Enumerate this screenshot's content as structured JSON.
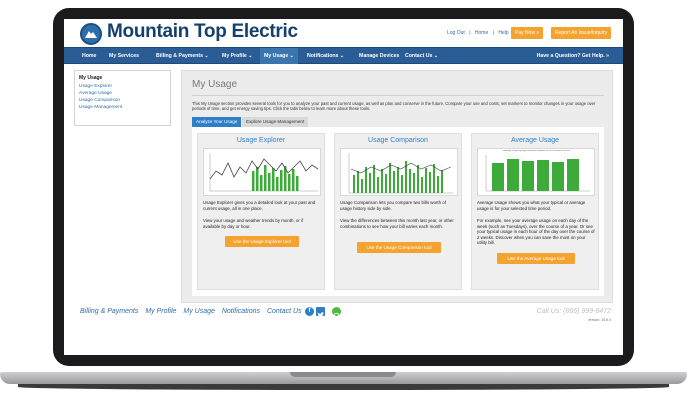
{
  "brand": {
    "name": "Mountain Top Electric",
    "accent": "#2a5d95",
    "orange": "#f4a331"
  },
  "top_links": [
    "Log Out",
    "|",
    "Home",
    "|",
    "Help"
  ],
  "header_buttons": {
    "pay": "Pay Now »",
    "report": "Report An Issue/Inquiry"
  },
  "nav": {
    "items": [
      "Home",
      "My Services",
      "Billing & Payments ⌄",
      "My Profile ⌄",
      "My Usage ⌄",
      "Notifications ⌄",
      "Manage Devices",
      "Contact Us ⌄"
    ],
    "active_index": 4,
    "help": "Have a Question? Get Help. »"
  },
  "sidebar": {
    "title": "My Usage",
    "links": [
      "Usage Explorer",
      "Average Usage",
      "Usage Comparison",
      "Usage Management"
    ]
  },
  "page": {
    "title": "My Usage",
    "intro": "This My Usage section provides several tools for you to analyze your past and current usage, as well as plan and conserve in the future. Compare your use and costs, set markers to monitor changes in your usage over periods of time, and get energy saving tips. Click the tabs below to learn more about these tools.",
    "tabs": [
      "Analyze Your Usage",
      "Explore Usage Management"
    ]
  },
  "cards": [
    {
      "title": "Usage Explorer",
      "text1": "Usage Explorer gives you a detailed look at your past and current usage, all in one place.",
      "text2": "View your usage and weather trends by month, or if available by day or hour.",
      "button": "Use the Usage Explorer tool"
    },
    {
      "title": "Usage Comparison",
      "text1": "Usage Comparison lets you compare two bills worth of usage history side by side.",
      "text2": "View the differences between this month last year, or other combinations to see how your bill varies each month.",
      "button": "Use the Usage Comparison tool"
    },
    {
      "title": "Average Usage",
      "chart_caption": "Average usage by day of the week between 10/5/2014 and 10/8/2014",
      "text1": "Average Usage shows you what your typical or average usage is for your selected time period.",
      "text2": "For example, see your average usage on each day of the week (such as Tuesdays), over the course of a year. Or see your typical usage in each hour of the day over the course of 2 weeks. Discover when you can save the most on your utility bill.",
      "button": "Use the Average Usage tool"
    }
  ],
  "footer": {
    "links": [
      "Billing & Payments",
      "My Profile",
      "My Usage",
      "Notifications",
      "Contact Us"
    ],
    "phone": "Call Us: (866) 999-8472",
    "version": "Version: 16.8.0"
  }
}
